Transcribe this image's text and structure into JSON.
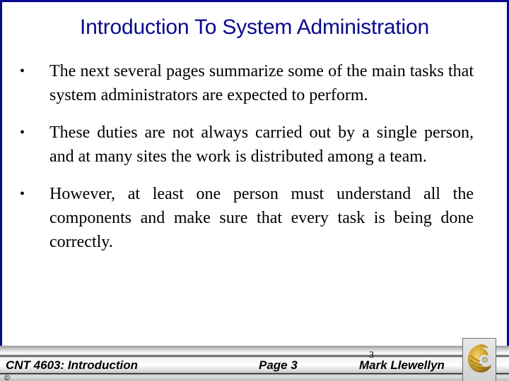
{
  "slide": {
    "title": "Introduction To System Administration",
    "bullet_glyph": "•",
    "bullets": [
      "The next several pages summarize some of the main tasks that system administrators are expected to perform.",
      "These duties are not always carried out by a single person, and at many sites the work is distributed among a team.",
      "However, at least one person must understand all the components and make sure that every task is being done correctly."
    ]
  },
  "footer": {
    "course": "CNT 4603: Introduction",
    "page": "Page 3",
    "author": "Mark Llewellyn",
    "slide_number": "3",
    "copyright": "©",
    "logo_icon": "pegasus-logo-icon"
  },
  "colors": {
    "border": "#0a0a8c",
    "title": "#0a0a8c",
    "logo_gold": "#c9a227"
  }
}
